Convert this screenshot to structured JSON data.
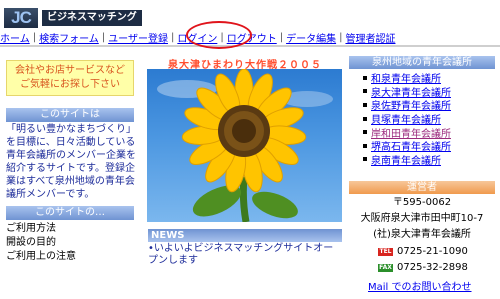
{
  "header": {
    "logo_mark": "JC",
    "logo_text": "ビジネスマッチング"
  },
  "nav": {
    "items": [
      {
        "label": "ホーム"
      },
      {
        "label": "検索フォーム"
      },
      {
        "label": "ユーザー登録"
      },
      {
        "label": "ログイン"
      },
      {
        "label": "ログアウト"
      },
      {
        "label": "データ編集"
      },
      {
        "label": "管理者認証"
      }
    ],
    "separator": "|"
  },
  "left": {
    "promo_line1": "会社やお店サービスなど",
    "promo_line2": "ご気軽にお探し下さい",
    "about_heading": "このサイトは",
    "about_text": "「明るい豊かなまちづくり」を目標に、日々活動している青年会議所のメンバー企業を紹介するサイトです。登録企業はすべて泉州地域の青年会議所メンバーです。",
    "links_heading": "このサイトの…",
    "links": [
      {
        "label": "ご利用方法"
      },
      {
        "label": "開設の目的"
      },
      {
        "label": "ご利用上の注意"
      }
    ]
  },
  "center": {
    "title": "泉大津ひまわり大作戦２００５",
    "news_heading": "NEWS",
    "news_items": [
      {
        "text": "•いよいよビジネスマッチングサイトオープンします"
      }
    ]
  },
  "right": {
    "members_heading": "泉州地域の青年会議所",
    "members": [
      {
        "label": "和泉青年会議所"
      },
      {
        "label": "泉大津青年会議所"
      },
      {
        "label": "泉佐野青年会議所"
      },
      {
        "label": "貝塚青年会議所"
      },
      {
        "label": "岸和田青年会議所"
      },
      {
        "label": "堺高石青年会議所"
      },
      {
        "label": "泉南青年会議所"
      }
    ],
    "operator_heading": "運営者",
    "postal": "〒595-0062",
    "address": "大阪府泉大津市田中町10-7",
    "org": "(社)泉大津青年会議所",
    "tel_label": "TEL",
    "tel": "0725-21-1090",
    "fax_label": "FAX",
    "fax": "0725-32-2898",
    "mail": "Mail でのお問い合わせ"
  },
  "colors": {
    "link": "#0000ee",
    "visited_link": "#9b2a7e",
    "highlight": "#e0141b",
    "section_blue": "#6f93d2",
    "operator_orange": "#f09a4d",
    "title_red": "#ff4d2e"
  }
}
